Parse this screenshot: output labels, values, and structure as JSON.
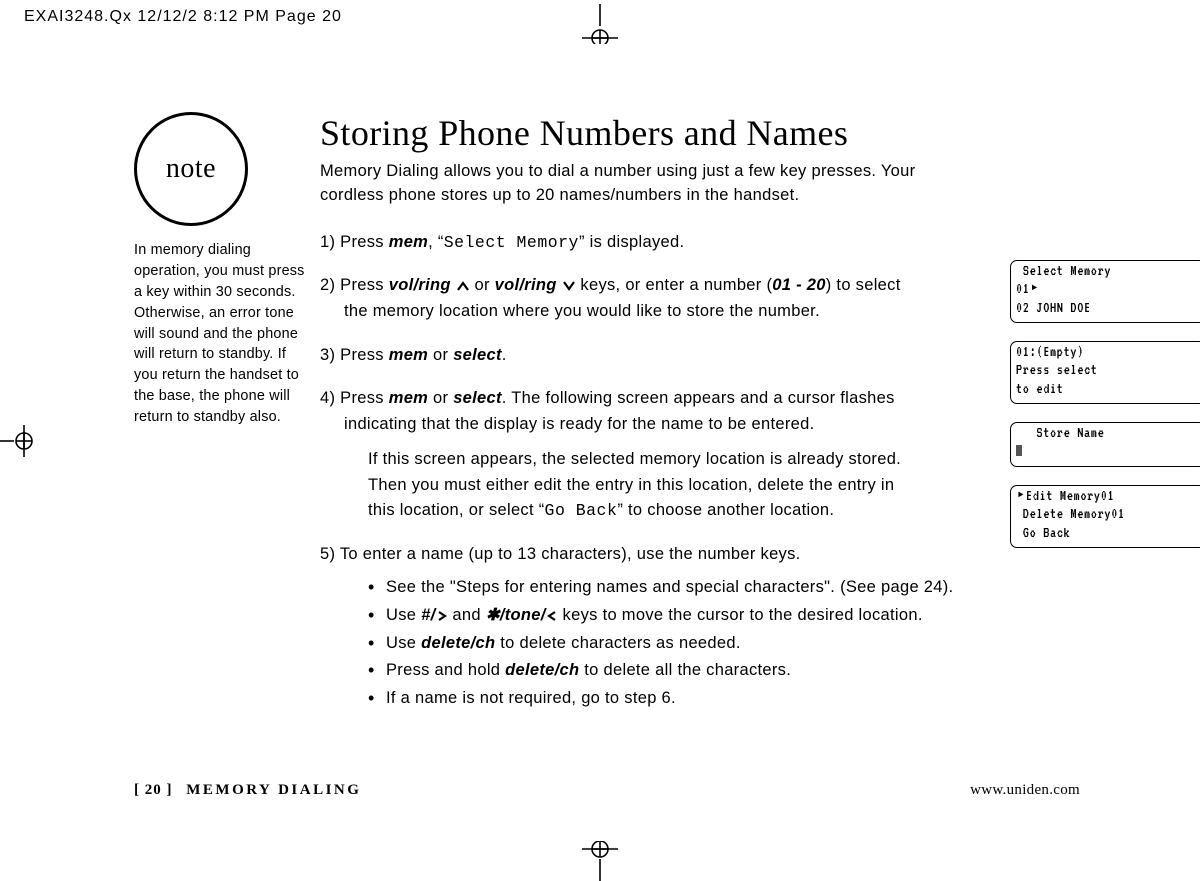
{
  "slug": "EXAI3248.Qx  12/12/2  8:12 PM  Page 20",
  "note": {
    "label": "note",
    "body": "In memory dialing operation, you must press a key within 30 seconds. Otherwise, an error tone will sound and the phone will return to standby. If you return the handset to the base, the phone will return to standby also."
  },
  "title": "Storing Phone Numbers and Names",
  "intro": "Memory Dialing allows you to dial a number using just a few key presses. Your cordless phone stores up to 20 names/numbers in the handset.",
  "steps": {
    "s1a": "1) Press ",
    "s1b": "mem",
    "s1c": ", “",
    "s1d": "Select Memory",
    "s1e": "” is displayed.",
    "s2a": "2) Press ",
    "s2b": "vol/ring",
    "s2c": " or ",
    "s2d": "vol/ring",
    "s2e": " keys, or enter a number (",
    "s2f": "01 - 20",
    "s2g": ") to select the memory location where you would like to store the number.",
    "s3a": "3) Press ",
    "s3b": "mem",
    "s3c": " or ",
    "s3d": "select",
    "s3e": ".",
    "s4a": "4) Press ",
    "s4b": "mem",
    "s4c": " or ",
    "s4d": "select",
    "s4e": ". The following screen appears and a cursor flashes indicating that the display is ready for the name to be entered.",
    "s4sub": "If this screen appears, the selected memory location is already stored. Then you must either edit the entry in this location, delete the entry in this location, or select “",
    "s4sub_mono": "Go Back",
    "s4sub2": "” to choose another location.",
    "s5a": "5) To enter a name (up to 13 characters), use the number keys.",
    "b1": "See the \"Steps for entering names and special characters\". (See page 24).",
    "b2a": "Use ",
    "b2b": "#/",
    "b2c": " and ",
    "b2d": "/tone/",
    "b2e": " keys to move the cursor to the desired location.",
    "b3a": "Use ",
    "b3b": "delete/ch",
    "b3c": " to delete characters as needed.",
    "b4a": "Press and hold ",
    "b4b": "delete/ch",
    "b4c": " to delete all the characters.",
    "b5": "If a name is not required, go to step 6."
  },
  "lcd": {
    "a": " Select Memory\n01‣\n02 JOHN DOE",
    "b": "01:(Empty)\nPress select\nto edit",
    "c_title": "   Store Name",
    "d": "‣Edit Memory01\n Delete Memory01\n Go Back"
  },
  "footer": {
    "page": "[ 20 ]",
    "section": "MEMORY DIALING",
    "url": "www.uniden.com"
  }
}
